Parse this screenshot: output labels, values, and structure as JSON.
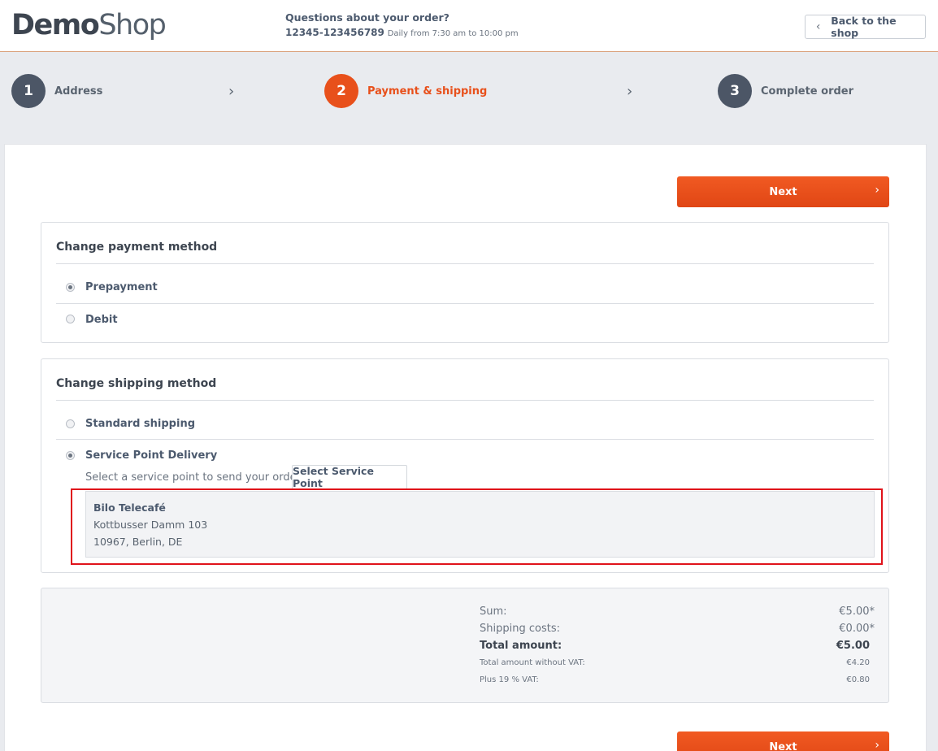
{
  "header": {
    "logo_bold": "Demo",
    "logo_light": "Shop",
    "help_title": "Questions about your order?",
    "phone": "12345-123456789",
    "hours": "Daily from 7:30 am to 10:00 pm",
    "back_label": "Back to the shop"
  },
  "steps": [
    {
      "number": "1",
      "label": "Address",
      "active": false
    },
    {
      "number": "2",
      "label": "Payment & shipping",
      "active": true
    },
    {
      "number": "3",
      "label": "Complete order",
      "active": false
    }
  ],
  "next_label": "Next",
  "payment": {
    "title": "Change payment method",
    "options": [
      {
        "label": "Prepayment",
        "checked": true
      },
      {
        "label": "Debit",
        "checked": false
      }
    ]
  },
  "shipping": {
    "title": "Change shipping method",
    "options": [
      {
        "label": "Standard shipping",
        "checked": false
      },
      {
        "label": "Service Point Delivery",
        "checked": true
      }
    ],
    "service_point_prompt": "Select a service point to send your order to",
    "service_point_button": "Select Service Point",
    "service_point": {
      "name": "Bilo Telecafé",
      "street": "Kottbusser Damm 103",
      "city": "10967, Berlin, DE"
    }
  },
  "summary": {
    "sum_label": "Sum:",
    "sum_value": "€5.00*",
    "shipping_label": "Shipping costs:",
    "shipping_value": "€0.00*",
    "total_label": "Total amount:",
    "total_value": "€5.00",
    "net_label": "Total amount without VAT:",
    "net_value": "€4.20",
    "vat_label": "Plus 19 % VAT:",
    "vat_value": "€0.80"
  },
  "colors": {
    "accent": "#e8501b",
    "highlight": "#e0131b",
    "step_inactive": "#4c5666"
  }
}
